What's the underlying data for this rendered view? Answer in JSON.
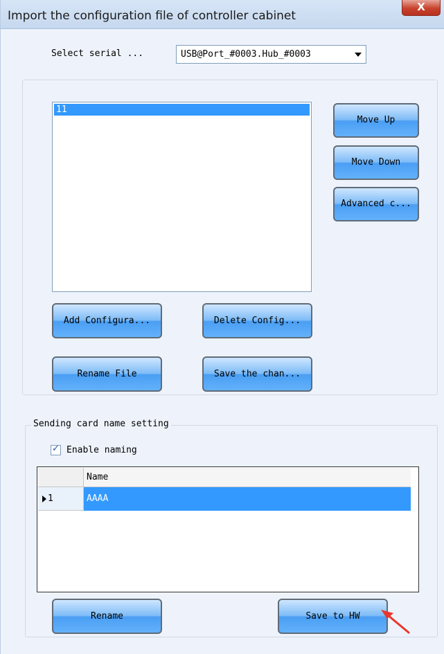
{
  "window": {
    "title": "Import the configuration file of controller cabinet",
    "close_label": "X"
  },
  "serial": {
    "label": "Select serial ...",
    "selected": "USB@Port_#0003.Hub_#0003"
  },
  "config_list": {
    "items": [
      "11"
    ],
    "selected_index": 0
  },
  "buttons": {
    "move_up": "Move Up",
    "move_down": "Move Down",
    "advanced": "Advanced c...",
    "add_config": "Add Configura...",
    "delete_config": "Delete Config...",
    "rename_file": "Rename File",
    "save_changes": "Save the chan...",
    "rename": "Rename",
    "save_to_hw": "Save to HW"
  },
  "naming": {
    "group_title": "Sending card name setting",
    "enable_label": "Enable naming",
    "enable_checked": true,
    "table": {
      "column_name": "Name",
      "rows": [
        {
          "index": "1",
          "name": "AAAA",
          "selected": true
        }
      ]
    }
  },
  "colors": {
    "selection": "#3399ff",
    "button_blue": "#4a9ef3",
    "pointer_red": "#e8372a"
  },
  "icons": {
    "close": "close-icon",
    "dropdown": "chevron-down-icon",
    "checkbox": "checkmark-icon",
    "row_indicator": "triangle-right-icon",
    "annotation": "red-arrow-pointer"
  }
}
